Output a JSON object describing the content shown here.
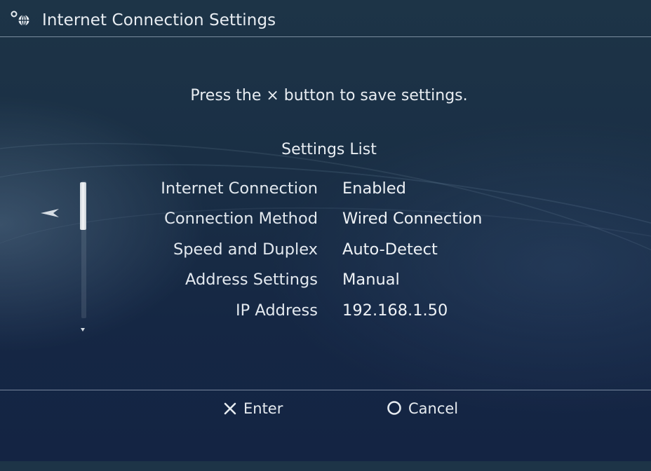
{
  "header": {
    "title": "Internet Connection Settings",
    "icon": "network-settings-icon"
  },
  "instruction": "Press the × button to save settings.",
  "list_title": "Settings List",
  "settings": [
    {
      "label": "Internet Connection",
      "value": "Enabled"
    },
    {
      "label": "Connection Method",
      "value": "Wired Connection"
    },
    {
      "label": "Speed and Duplex",
      "value": "Auto-Detect"
    },
    {
      "label": "Address Settings",
      "value": "Manual"
    },
    {
      "label": "IP Address",
      "value": "192.168.1.50"
    }
  ],
  "footer": {
    "enter_label": "Enter",
    "cancel_label": "Cancel"
  },
  "colors": {
    "background_top": "#1d3447",
    "background_bottom": "#142443",
    "text": "#e8edf2"
  }
}
